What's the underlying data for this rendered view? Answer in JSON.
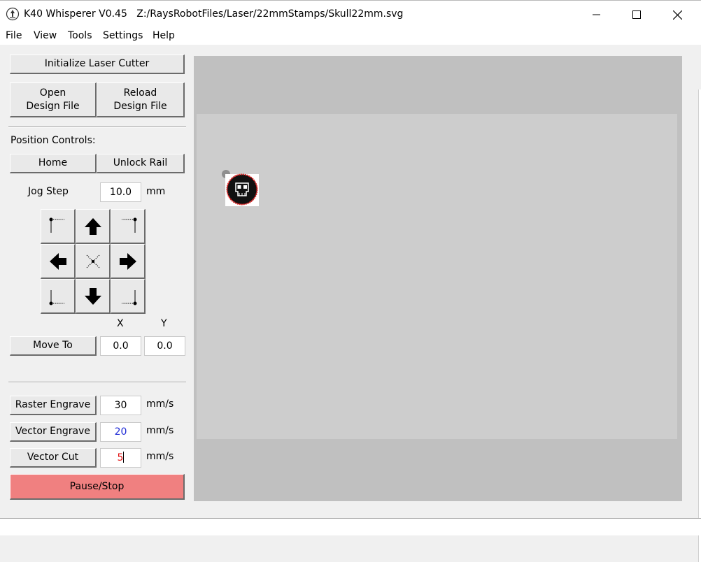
{
  "window": {
    "app_title": "K40 Whisperer V0.45",
    "file_path": "Z:/RaysRobotFiles/Laser/22mmStamps/Skull22mm.svg"
  },
  "menu": [
    "File",
    "View",
    "Tools",
    "Settings",
    "Help"
  ],
  "buttons": {
    "initialize": "Initialize Laser Cutter",
    "open_line1": "Open",
    "open_line2": "Design File",
    "reload_line1": "Reload",
    "reload_line2": "Design File",
    "home": "Home",
    "unlock_rail": "Unlock Rail",
    "move_to": "Move To",
    "raster_engrave": "Raster Engrave",
    "vector_engrave": "Vector Engrave",
    "vector_cut": "Vector Cut",
    "pause_stop": "Pause/Stop"
  },
  "position_controls": {
    "heading": "Position Controls:",
    "jog_step_label": "Jog Step",
    "jog_step_value": "10.0",
    "jog_step_unit": "mm",
    "x_label": "X",
    "y_label": "Y",
    "x_value": "0.0",
    "y_value": "0.0"
  },
  "speeds": {
    "raster_value": "30",
    "vector_engrave_value": "20",
    "vector_cut_value": "5",
    "unit": "mm/s"
  },
  "colors": {
    "pause_button": "#f08080",
    "vector_engrave_text": "#1f2bd6",
    "vector_cut_text": "#e01010"
  },
  "icons": {
    "jog_up": "arrow-up-icon",
    "jog_down": "arrow-down-icon",
    "jog_left": "arrow-left-icon",
    "jog_right": "arrow-right-icon",
    "jog_center": "center-x-icon",
    "jog_corners": [
      "top-left-corner-icon",
      "top-right-corner-icon",
      "bottom-left-corner-icon",
      "bottom-right-corner-icon"
    ]
  }
}
